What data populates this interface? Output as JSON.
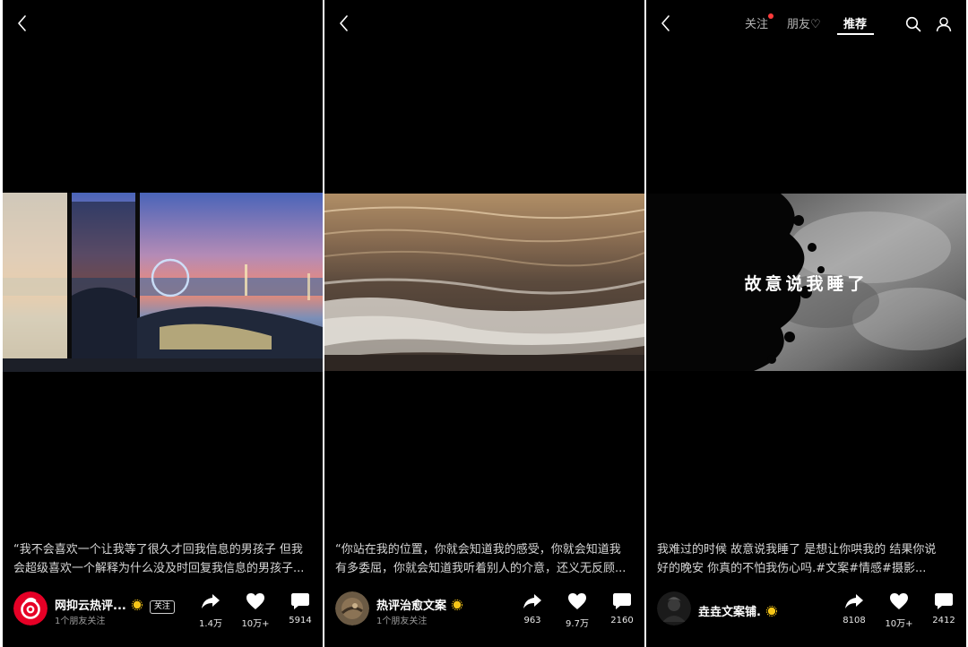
{
  "panels": [
    {
      "description_lines": [
        "“我不会喜欢一个让我等了很久才回我信息的男孩子 但我",
        "会超级喜欢一个解释为什么没及时回复我信息的男孩子..."
      ],
      "author": {
        "name": "网抑云热评...",
        "sub": "1个朋友关注",
        "follow_label": "关注",
        "verified": true
      },
      "actions": {
        "share": "1.4万",
        "like": "10万+",
        "comment": "5914"
      }
    },
    {
      "description_lines": [
        "“你站在我的位置，你就会知道我的感受，你就会知道我",
        "有多委屈，你就会知道我听着别人的介意，还义无反顾..."
      ],
      "author": {
        "name": "热评治愈文案",
        "sub": "1个朋友关注",
        "verified": true
      },
      "actions": {
        "share": "963",
        "like": "9.7万",
        "comment": "2160"
      }
    },
    {
      "nav": {
        "follow": "关注",
        "friends": "朋友♡",
        "recommend": "推荐"
      },
      "overlay_text": "故意说我睡了",
      "description_lines": [
        "我难过的时候 故意说我睡了 是想让你哄我的 结果你说",
        "好的晚安 你真的不怕我伤心吗.#文案#情感#摄影..."
      ],
      "author": {
        "name": "垚垚文案铺.",
        "verified": true
      },
      "actions": {
        "share": "8108",
        "like": "10万+",
        "comment": "2412"
      }
    }
  ],
  "colors": {
    "background": "#000000",
    "notification_dot": "#ff3b3b",
    "verified_badge": "#f5c518",
    "avatar_netease": "#e60026"
  },
  "icons": [
    "back-chevron-icon",
    "search-icon",
    "profile-icon",
    "share-arrow-icon",
    "heart-icon",
    "comment-bubble-icon",
    "verified-badge-icon"
  ]
}
